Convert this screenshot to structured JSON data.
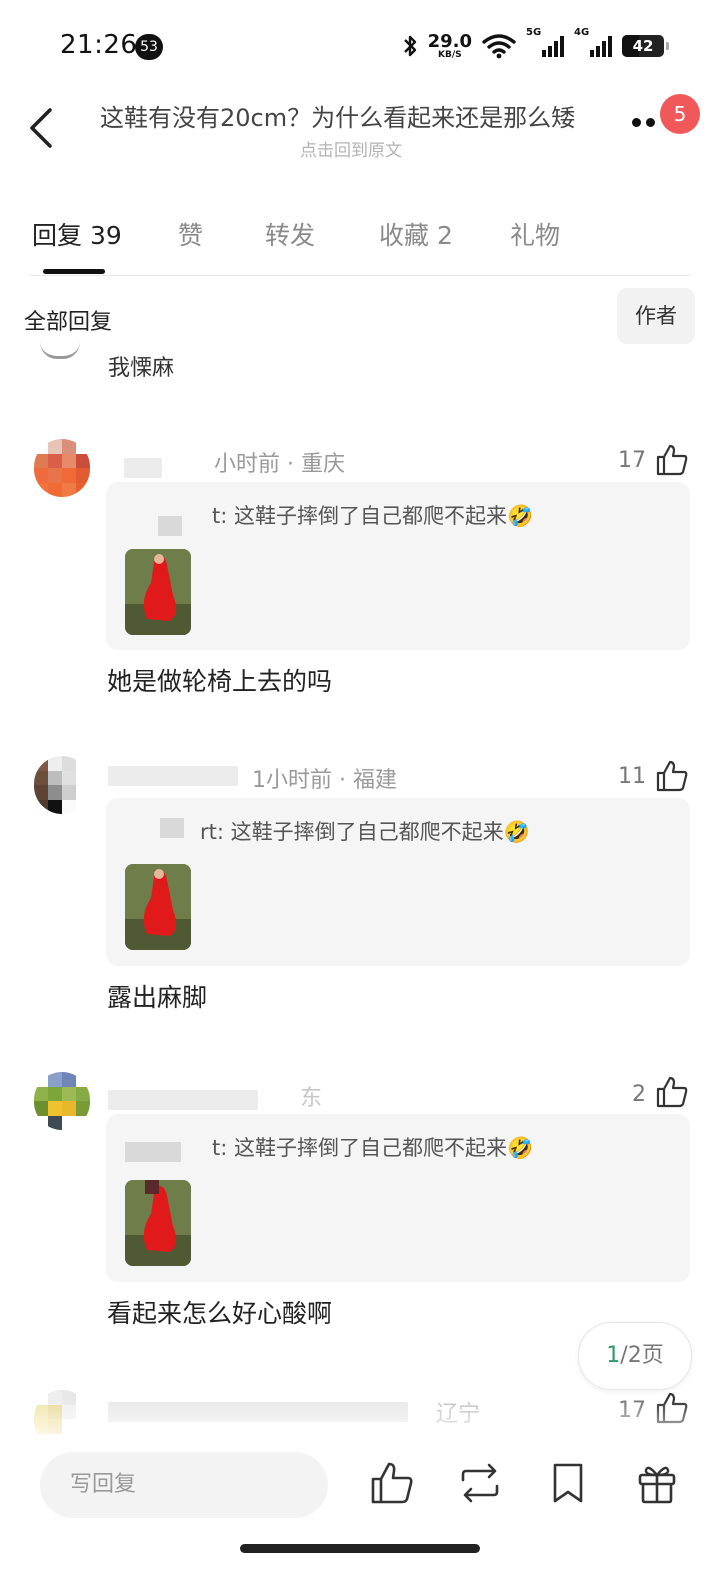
{
  "status_bar": {
    "time": "21:26",
    "notification_count": "53",
    "net_speed": "29.0",
    "net_unit": "KB/S",
    "sig1_label": "5G",
    "sig2_label": "4G",
    "battery": "42"
  },
  "header": {
    "title": "这鞋有没有20cm？为什么看起来还是那么矮",
    "subtitle": "点击回到原文",
    "badge": "5"
  },
  "tabs": [
    {
      "label": "回复 39"
    },
    {
      "label": "赞"
    },
    {
      "label": "转发"
    },
    {
      "label": "收藏 2"
    },
    {
      "label": "礼物"
    }
  ],
  "filter": {
    "all_label": "全部回复",
    "author_label": "作者"
  },
  "partial_comment": {
    "text": "我慄麻"
  },
  "comments": [
    {
      "meta": "小时前 · 重庆",
      "likes": "17",
      "quote": "t: 这鞋子摔倒了自己都爬不起来🤣",
      "reply": "她是做轮椅上去的吗"
    },
    {
      "meta": "1小时前 · 福建",
      "likes": "11",
      "quote": "rt: 这鞋子摔倒了自己都爬不起来🤣",
      "reply": "露出麻脚"
    },
    {
      "meta": "东",
      "likes": "2",
      "quote": "t: 这鞋子摔倒了自己都爬不起来🤣",
      "reply": "看起来怎么好心酸啊"
    },
    {
      "meta": "辽宁",
      "likes": "17"
    }
  ],
  "pagination": {
    "current": "1",
    "rest": "/2页"
  },
  "bottom_bar": {
    "reply_placeholder": "写回复"
  },
  "colors": {
    "badge_red": "#f0585a",
    "page_green": "#2d9c6a",
    "quote_bg": "#f5f5f5"
  }
}
